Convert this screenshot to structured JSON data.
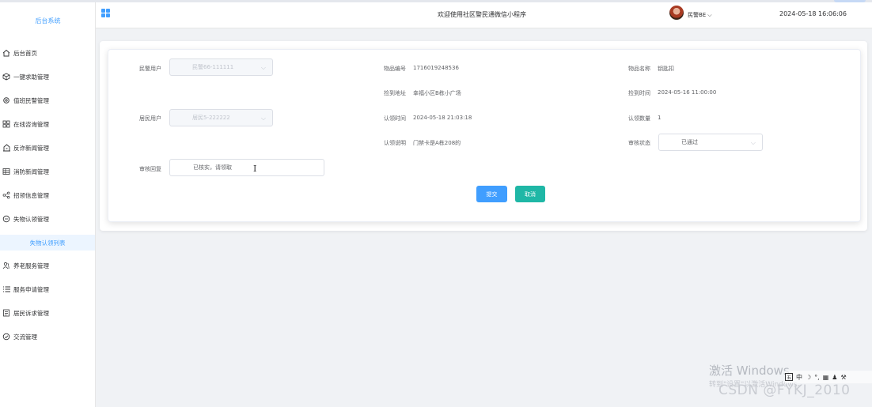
{
  "sidebar": {
    "brand": "后台系统",
    "items": [
      {
        "label": "后台首页",
        "icon": "home-icon"
      },
      {
        "label": "一键求助管理",
        "icon": "box-icon"
      },
      {
        "label": "值班民警管理",
        "icon": "gear-icon"
      },
      {
        "label": "在线咨询管理",
        "icon": "grid-icon"
      },
      {
        "label": "反诈新闻管理",
        "icon": "home-alert-icon"
      },
      {
        "label": "消防新闻管理",
        "icon": "table-icon"
      },
      {
        "label": "招领信息管理",
        "icon": "share-icon"
      },
      {
        "label": "失物认领管理",
        "icon": "chat-icon"
      },
      {
        "label": "失物认领列表",
        "icon": ""
      },
      {
        "label": "养老服务管理",
        "icon": "people-icon"
      },
      {
        "label": "服务申请管理",
        "icon": "list-icon"
      },
      {
        "label": "居民诉求管理",
        "icon": "document-icon"
      },
      {
        "label": "交流管理",
        "icon": "check-circle-icon"
      }
    ]
  },
  "header": {
    "title": "欢迎使用社区警民通微信小程序",
    "user": "民警BE",
    "datetime": "2024-05-18 16:06:06"
  },
  "form": {
    "police_user_label": "民警用户",
    "police_user_value": "民警66-111111",
    "resident_user_label": "居民用户",
    "resident_user_value": "居民5-222222",
    "item_no_label": "物品编号",
    "item_no_value": "1716019248536",
    "item_name_label": "物品名称",
    "item_name_value": "钥匙扣",
    "pickup_addr_label": "捡到地址",
    "pickup_addr_value": "幸福小区B栋小广场",
    "pickup_time_label": "捡到时间",
    "pickup_time_value": "2024-05-16 11:00:00",
    "claim_time_label": "认领时间",
    "claim_time_value": "2024-05-18 21:03:18",
    "claim_count_label": "认领数量",
    "claim_count_value": "1",
    "claim_desc_label": "认领说明",
    "claim_desc_value": "门禁卡是A栋208的",
    "review_status_label": "审核状态",
    "review_status_value": "已通过",
    "review_reply_label": "审核回复",
    "review_reply_value": "已核实，请领取",
    "submit_label": "提交",
    "cancel_label": "取消"
  },
  "watermark": {
    "windows_line1": "激活 Windows",
    "windows_line2": "转到\"设置\"以激活Windows。",
    "csdn": "CSDN @FYKJ_2010"
  },
  "tray": {
    "ime": "中",
    "box": "五"
  },
  "colors": {
    "primary": "#409eff",
    "success": "#1fb7a6",
    "sidebar_active_bg": "#ecf5ff"
  }
}
